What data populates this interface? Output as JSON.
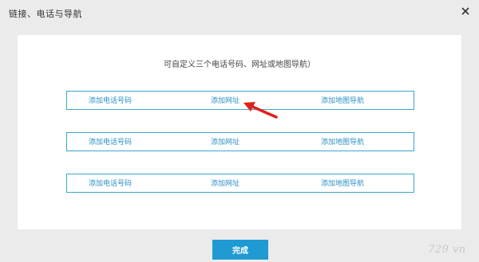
{
  "dialog": {
    "title": "链接、电话与导航",
    "close_icon": "close-icon"
  },
  "panel": {
    "instruction": "可自定义三个电话号码、网址或地图导航）",
    "rows": [
      {
        "phone": "添加电话号码",
        "website": "添加网址",
        "map": "添加地图导航"
      },
      {
        "phone": "添加电话号码",
        "website": "添加网址",
        "map": "添加地图导航"
      },
      {
        "phone": "添加电话号码",
        "website": "添加网址",
        "map": "添加地图导航"
      }
    ]
  },
  "annotation": {
    "icon": "red-arrow-icon",
    "color": "#e0201b"
  },
  "footer": {
    "done_label": "完成"
  },
  "watermark": {
    "text": "729 vn"
  },
  "colors": {
    "accent": "#1f9ad3",
    "border": "#3aa5cf",
    "link": "#2a8fc5"
  }
}
